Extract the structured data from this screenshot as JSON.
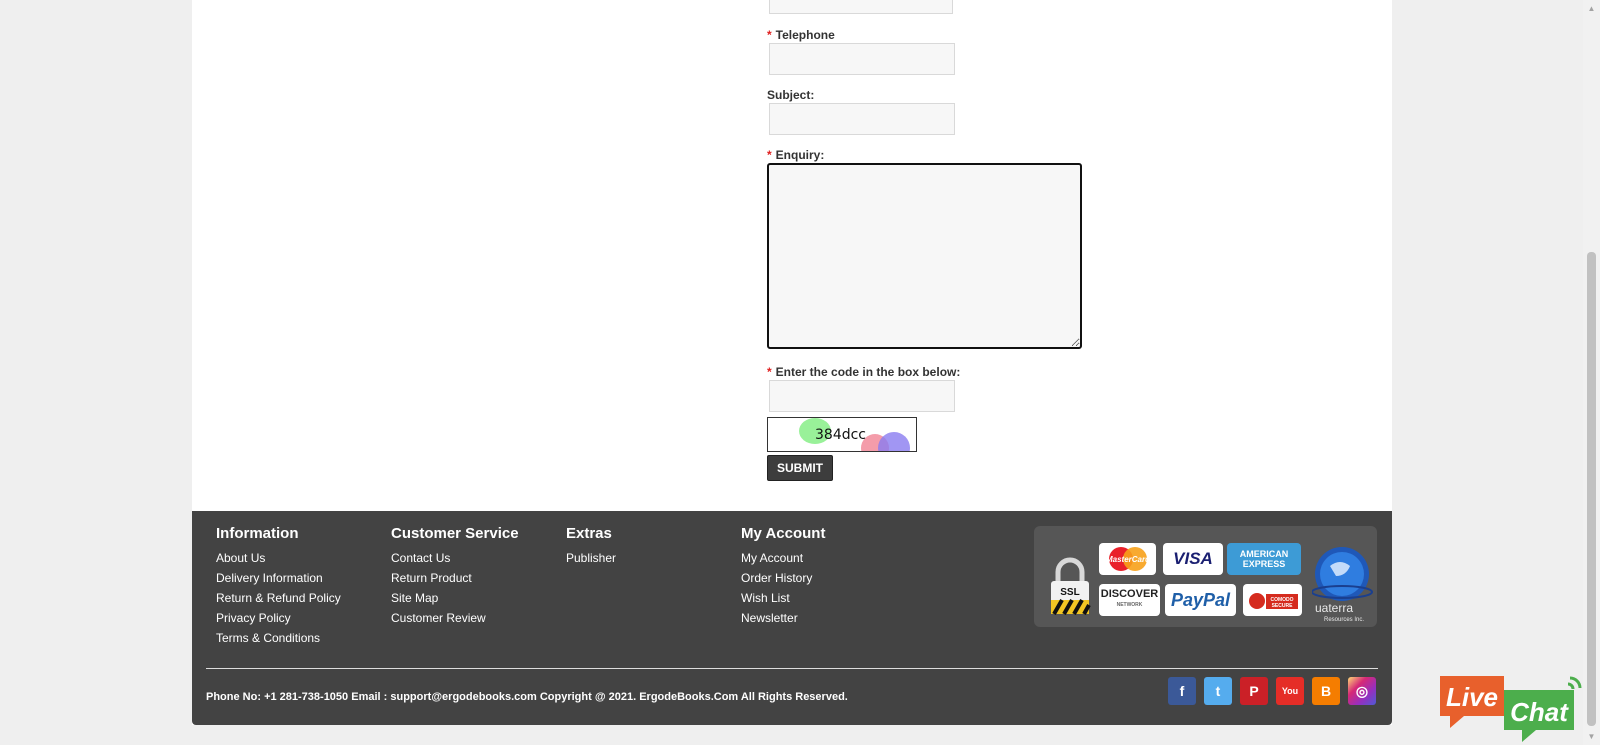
{
  "form": {
    "telephone_label": "Telephone",
    "subject_label": "Subject:",
    "enquiry_label": "Enquiry:",
    "captcha_label": "Enter the code in the box below:",
    "captcha_code": "384dcc",
    "required_mark": "*",
    "submit_label": "SUBMIT"
  },
  "footer": {
    "columns": [
      {
        "title": "Information",
        "links": [
          "About Us",
          "Delivery Information",
          "Return & Refund Policy",
          "Privacy Policy",
          "Terms & Conditions"
        ]
      },
      {
        "title": "Customer Service",
        "links": [
          "Contact Us",
          "Return Product",
          "Site Map",
          "Customer Review"
        ]
      },
      {
        "title": "Extras",
        "links": [
          "Publisher"
        ]
      },
      {
        "title": "My Account",
        "links": [
          "My Account",
          "Order History",
          "Wish List",
          "Newsletter"
        ]
      }
    ],
    "badges": {
      "ssl": "SSL",
      "mastercard": "MasterCard",
      "visa": "VISA",
      "amex_line1": "AMERICAN",
      "amex_line2": "EXPRESS",
      "discover": "DISCOVER",
      "discover_sub": "NETWORK",
      "paypal": "PayPal",
      "comodo_line1": "COMODO",
      "comodo_line2": "SECURE",
      "uaterra": "uaterra",
      "uaterra_sub": "Resources Inc."
    },
    "phone_label": "Phone No:",
    "phone": "+1 281-738-1050",
    "email_label": "Email :",
    "email": "support@ergodebooks.com",
    "copyright": "Copyright @ 2021. ErgodeBooks.Com All Rights Reserved.",
    "social": [
      {
        "name": "facebook",
        "glyph": "f",
        "color": "#3b5998"
      },
      {
        "name": "twitter",
        "glyph": "t",
        "color": "#55acee"
      },
      {
        "name": "pinterest",
        "glyph": "P",
        "color": "#cb2027"
      },
      {
        "name": "youtube",
        "glyph": "You",
        "color": "#e52d27"
      },
      {
        "name": "blogger",
        "glyph": "B",
        "color": "#f57d00"
      },
      {
        "name": "instagram",
        "glyph": "◎",
        "color": "#c13584"
      }
    ]
  },
  "livechat": {
    "word1": "Live",
    "word2": "Chat",
    "color1": "#e8602c",
    "color2": "#4cae4c"
  }
}
